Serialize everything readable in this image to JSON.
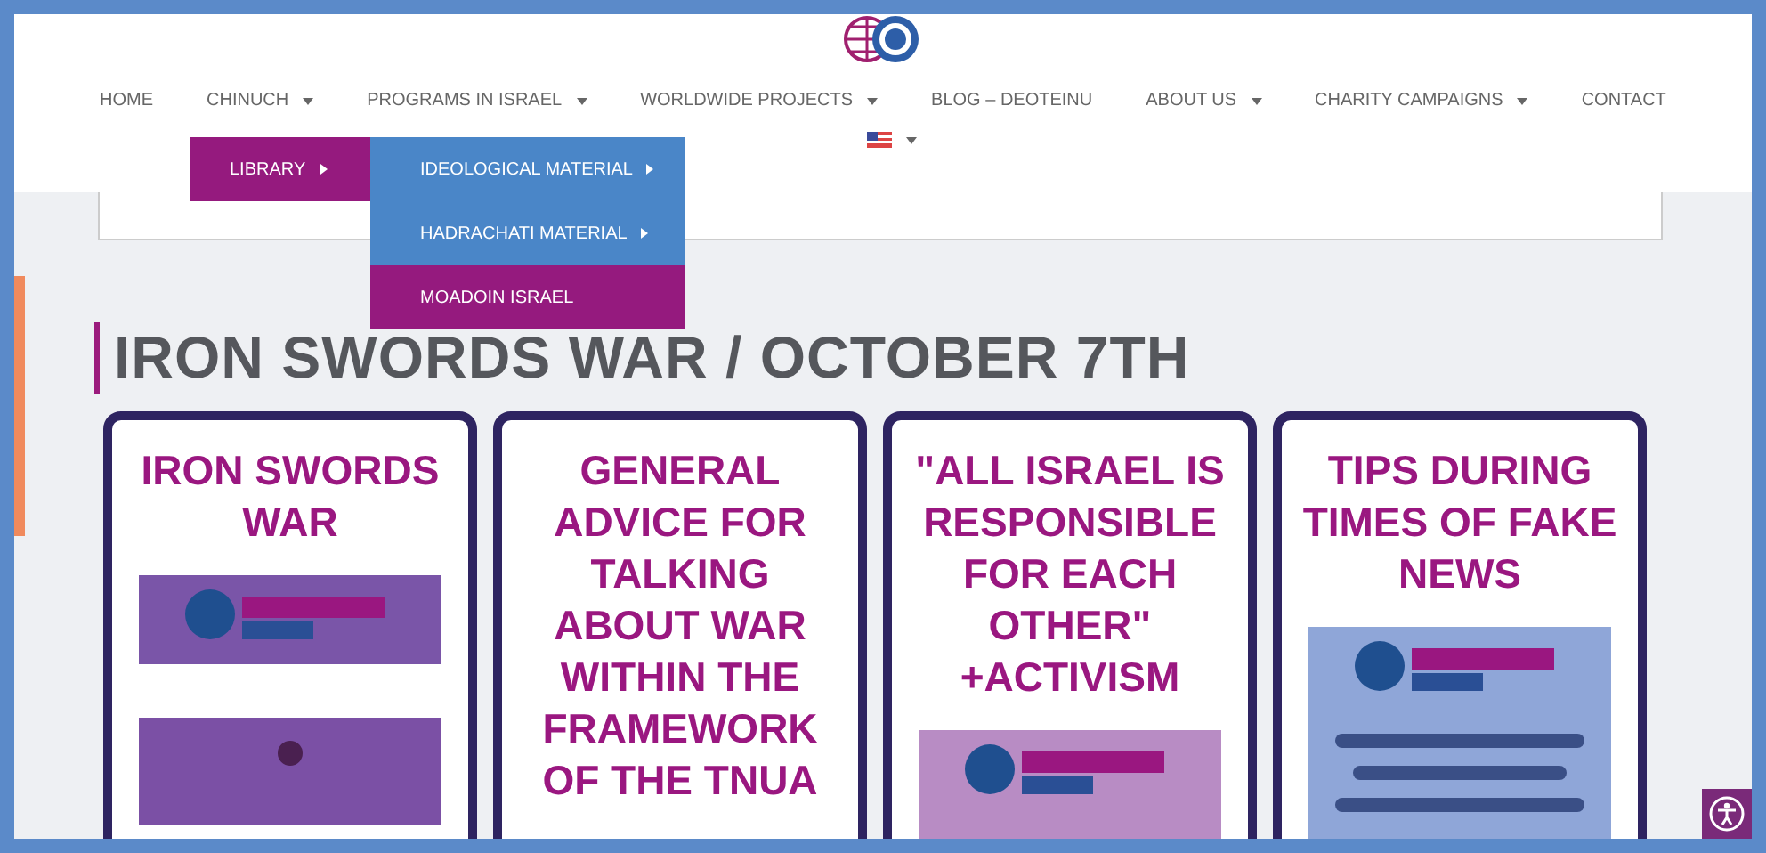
{
  "nav": [
    {
      "label": "HOME",
      "has_dropdown": false
    },
    {
      "label": "CHINUCH",
      "has_dropdown": true
    },
    {
      "label": "PROGRAMS IN ISRAEL",
      "has_dropdown": true
    },
    {
      "label": "WORLDWIDE PROJECTS",
      "has_dropdown": true
    },
    {
      "label": "BLOG – DEOTEINU",
      "has_dropdown": false
    },
    {
      "label": "ABOUT US",
      "has_dropdown": true
    },
    {
      "label": "CHARITY CAMPAIGNS",
      "has_dropdown": true
    },
    {
      "label": "CONTACT",
      "has_dropdown": false
    }
  ],
  "dropdown": {
    "items": [
      {
        "label": "LIBRARY",
        "has_submenu": true,
        "highlighted": true
      }
    ]
  },
  "submenu": {
    "items": [
      {
        "label": "IDEOLOGICAL MATERIAL",
        "has_submenu": true,
        "highlighted": false
      },
      {
        "label": "HADRACHATI MATERIAL",
        "has_submenu": true,
        "highlighted": false
      },
      {
        "label": "MOADOIN ISRAEL",
        "has_submenu": false,
        "highlighted": true
      }
    ]
  },
  "heading": "IRON SWORDS WAR / OCTOBER 7TH",
  "cards": [
    {
      "title": "IRON SWORDS WAR"
    },
    {
      "title": "GENERAL ADVICE FOR TALKING ABOUT WAR WITHIN THE FRAMEWORK OF THE TNUA"
    },
    {
      "title": "\"ALL ISRAEL IS RESPONSIBLE FOR EACH OTHER\" +ACTIVISM"
    },
    {
      "title": "TIPS DURING TIMES OF FAKE NEWS"
    }
  ]
}
